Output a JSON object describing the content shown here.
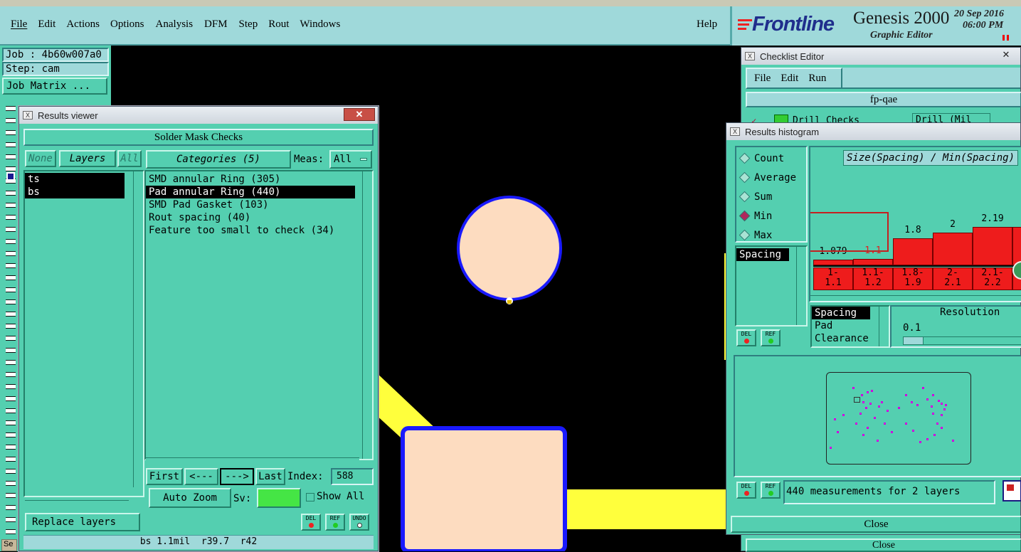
{
  "menubar": {
    "items": [
      "File",
      "Edit",
      "Actions",
      "Options",
      "Analysis",
      "DFM",
      "Step",
      "Rout",
      "Windows"
    ],
    "help": "Help"
  },
  "brand": {
    "logo": "Frontline",
    "product": "Genesis 2000",
    "subtitle": "Graphic Editor",
    "date": "20 Sep 2016",
    "time": "06:00 PM"
  },
  "job_panel": {
    "job": "Job : 4b60w007a0",
    "step": "Step: cam",
    "job_matrix": "Job Matrix ..."
  },
  "results_viewer": {
    "window_title": "Results viewer",
    "header": "Solder Mask Checks",
    "none_btn": "None",
    "layers_btn": "Layers",
    "all_btn": "All",
    "layers": [
      {
        "name": "ts",
        "selected": true
      },
      {
        "name": "bs",
        "selected": true
      }
    ],
    "categories_btn": "Categories (5)",
    "meas_label": "Meas:",
    "meas_value": "All",
    "categories": [
      {
        "text": "SMD annular Ring (305)",
        "selected": false
      },
      {
        "text": "Pad annular Ring (440)",
        "selected": true
      },
      {
        "text": "SMD Pad Gasket (103)",
        "selected": false
      },
      {
        "text": "Rout spacing (40)",
        "selected": false
      },
      {
        "text": "Feature too small to check (34)",
        "selected": false
      }
    ],
    "first_btn": "First",
    "prev_btn": "<---",
    "next_btn": "--->",
    "last_btn": "Last",
    "index_label": "Index:",
    "index_value": "588",
    "auto_zoom": "Auto Zoom",
    "sv_label": "Sv:",
    "show_all": "Show All",
    "replace_layers": "Replace layers",
    "del": "DEL",
    "ref": "REF",
    "undo": "UNDO",
    "status": "bs 1.1mil  r39.7  r42"
  },
  "checklist_editor": {
    "window_title": "Checklist Editor",
    "menu": [
      "File",
      "Edit",
      "Run"
    ],
    "name": "fp-qae",
    "row_text": "Drill Checks",
    "row_field": "Drill (Mil",
    "close": "Close"
  },
  "histogram": {
    "window_title": "Results histogram",
    "modes": [
      {
        "label": "Count",
        "on": false
      },
      {
        "label": "Average",
        "on": false
      },
      {
        "label": "Sum",
        "on": false
      },
      {
        "label": "Min",
        "on": true
      },
      {
        "label": "Max",
        "on": false
      }
    ],
    "metric_selected": "Spacing",
    "title": "Size(Spacing) / Min(Spacing)",
    "bins": [
      {
        "value_label": "1.079",
        "range": "1-\n1.1",
        "value": 1.079,
        "highlight": false
      },
      {
        "value_label": "1.1",
        "range": "1.1-\n1.2",
        "value": 1.1,
        "highlight": true
      },
      {
        "value_label": "1.8",
        "range": "1.8-\n1.9",
        "value": 1.8,
        "highlight": false
      },
      {
        "value_label": "2",
        "range": "2-\n2.1",
        "value": 2,
        "highlight": false
      },
      {
        "value_label": "2.19",
        "range": "2.1-\n2.2",
        "value": 2.19,
        "highlight": false
      },
      {
        "value_label": "",
        "range": "",
        "value": 2.19,
        "highlight": false
      }
    ],
    "attributes": [
      "Spacing",
      "Pad",
      "Clearance"
    ],
    "resolution_label": "Resolution",
    "resolution_value": "0.1",
    "measurements": "440 measurements for 2 layers",
    "close": "Close",
    "del": "DEL",
    "ref": "REF"
  },
  "taskbar": {
    "label": "Se"
  },
  "colors": {
    "panel": "#54cfb0",
    "menubar": "#9fd9da",
    "pad_fill": "#fddcc0",
    "outline": "#1a1aff",
    "trace": "#ffff3c",
    "bar": "#ee1c1c"
  }
}
